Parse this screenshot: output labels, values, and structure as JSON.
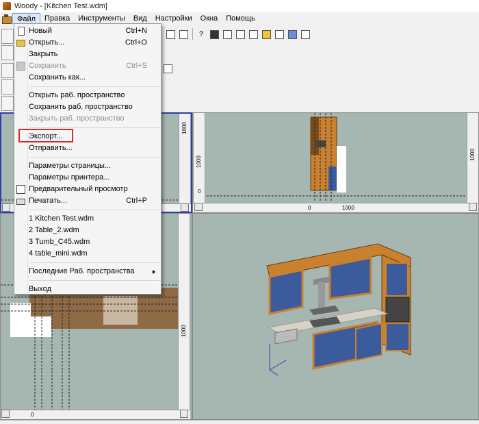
{
  "window": {
    "title": "Woody - [Kitchen Test.wdm]"
  },
  "menubar": {
    "items": [
      "Файл",
      "Правка",
      "Инструменты",
      "Вид",
      "Настройки",
      "Окна",
      "Помощь"
    ]
  },
  "file_menu": {
    "new": {
      "label": "Новый",
      "shortcut": "Ctrl+N"
    },
    "open": {
      "label": "Открыть...",
      "shortcut": "Ctrl+O"
    },
    "close": {
      "label": "Закрыть"
    },
    "save": {
      "label": "Сохранить",
      "shortcut": "Ctrl+S"
    },
    "save_as": {
      "label": "Сохранить как..."
    },
    "open_ws": {
      "label": "Открыть раб. пространство"
    },
    "save_ws": {
      "label": "Сохранить раб. пространство"
    },
    "close_ws": {
      "label": "Закрыть раб. пространство"
    },
    "export": {
      "label": "Экспорт..."
    },
    "send": {
      "label": "Отправить..."
    },
    "page_setup": {
      "label": "Параметры страницы..."
    },
    "printer_setup": {
      "label": "Параметры принтера..."
    },
    "preview": {
      "label": "Предварительный просмотр"
    },
    "print": {
      "label": "Печатать...",
      "shortcut": "Ctrl+P"
    },
    "recent": [
      "1 Kitchen Test.wdm",
      "2 Table_2.wdm",
      "3 Tumb_C45.wdm",
      "4 table_mini.wdm"
    ],
    "recent_ws": {
      "label": "Последние Раб. пространства"
    },
    "exit": {
      "label": "Выход"
    }
  },
  "rulers": {
    "tr_vertical": "1000",
    "tr_horizontal": "1000",
    "bl_vertical": "1000",
    "tl_vertical": "1000",
    "zero": "0"
  },
  "colors": {
    "viewport_bg": "#a6b6b1",
    "active_border": "#2b3fae",
    "highlight": "#e0262b",
    "cabinet_blue": "#3c5b9c",
    "wood": "#c9812f"
  }
}
